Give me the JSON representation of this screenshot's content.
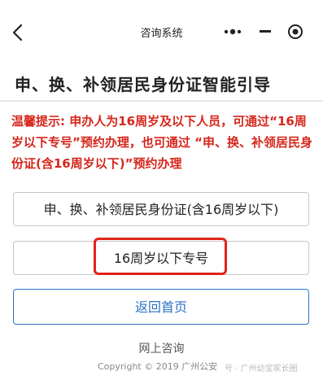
{
  "nav": {
    "title": "咨询系统",
    "back_icon": "chevron-left-icon",
    "more_icon": "more-dots-icon",
    "minimize_icon": "minimize-icon",
    "close_icon": "target-close-icon"
  },
  "page": {
    "title": "申、换、补领居民身份证智能引导",
    "tip": "温馨提示: 申办人为16周岁及以下人员，可通过“16周岁以下专号”预约办理，也可通过 “申、换、补领居民身份证(含16周岁以下)”预约办理"
  },
  "buttons": {
    "id_card": "申、换、补领居民身份证(含16周岁以下)",
    "under16": "16周岁以下专号",
    "home": "返回首页"
  },
  "footer": {
    "online_consult": "网上咨询",
    "copyright": "Copyright © 2019 广州公安",
    "watermark": "号 · 广州幼宝家长圈"
  },
  "colors": {
    "tip_red": "#d6261c",
    "link_blue": "#2b74c4",
    "highlight_red": "#e0241b"
  }
}
